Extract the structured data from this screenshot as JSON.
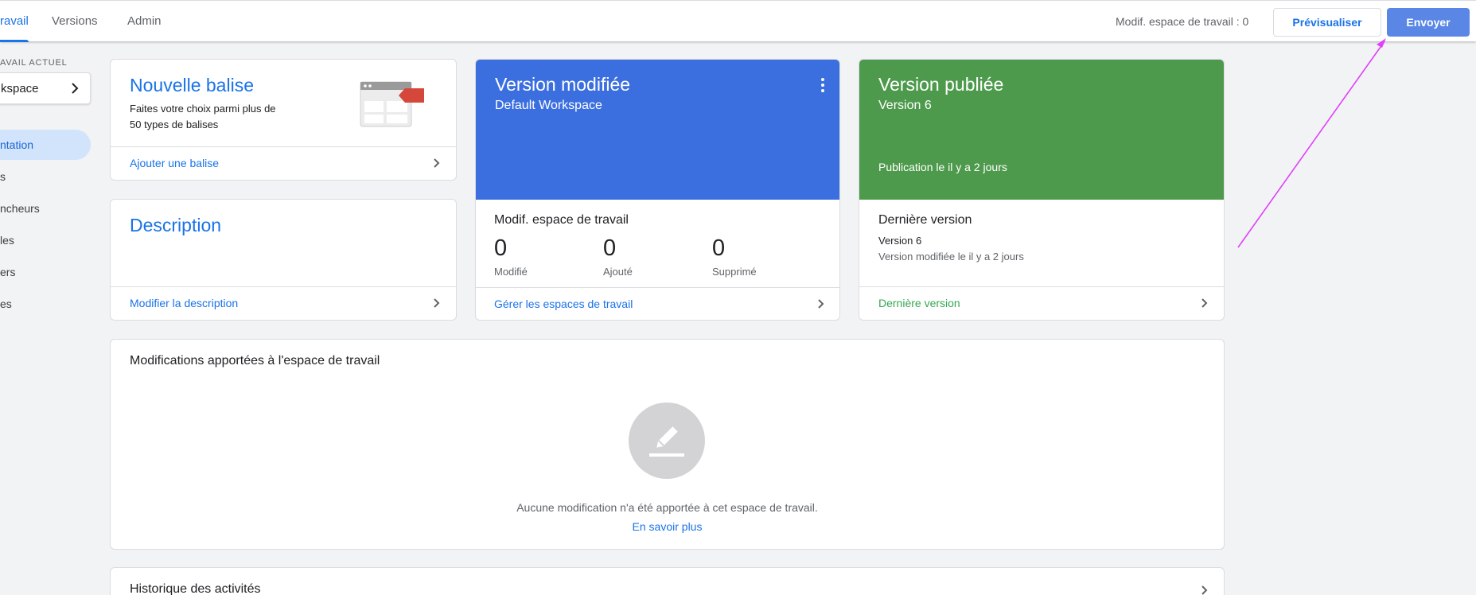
{
  "tabs": [
    {
      "label": "ravail"
    },
    {
      "label": "Versions"
    },
    {
      "label": "Admin"
    }
  ],
  "header": {
    "workspace_changes": "Modif. espace de travail : 0",
    "preview_label": "Prévisualiser",
    "submit_label": "Envoyer"
  },
  "sidebar": {
    "workspace_label": "AVAIL ACTUEL",
    "workspace_name": "kspace",
    "items": [
      {
        "label": "ntation"
      },
      {
        "label": "s"
      },
      {
        "label": "ncheurs"
      },
      {
        "label": "les"
      },
      {
        "label": "ers"
      },
      {
        "label": "es"
      }
    ]
  },
  "new_tag": {
    "title": "Nouvelle balise",
    "desc_line1": "Faites votre choix parmi plus de",
    "desc_line2": "50 types de balises",
    "link": "Ajouter une balise"
  },
  "description": {
    "title": "Description",
    "link": "Modifier la description"
  },
  "modified_version": {
    "title": "Version modifiée",
    "subtitle": "Default Workspace",
    "section_title": "Modif. espace de travail",
    "stats": [
      {
        "value": "0",
        "label": "Modifié"
      },
      {
        "value": "0",
        "label": "Ajouté"
      },
      {
        "value": "0",
        "label": "Supprimé"
      }
    ],
    "link": "Gérer les espaces de travail"
  },
  "published_version": {
    "title": "Version publiée",
    "subtitle": "Version 6",
    "published_text": "Publication le il y a 2 jours",
    "section_title": "Dernière version",
    "version": "Version 6",
    "modified_text": "Version modifiée le il y a 2 jours",
    "link": "Dernière version"
  },
  "workspace_changes": {
    "title": "Modifications apportées à l'espace de travail",
    "empty_text": "Aucune modification n'a été apportée à cet espace de travail.",
    "learn_more": "En savoir plus"
  },
  "activity": {
    "title": "Historique des activités"
  },
  "colors": {
    "accent": "#1a73e8",
    "blue_banner": "#3b6fe0",
    "green_banner": "#4e9a4d",
    "annotation_arrow": "#e040fb"
  }
}
